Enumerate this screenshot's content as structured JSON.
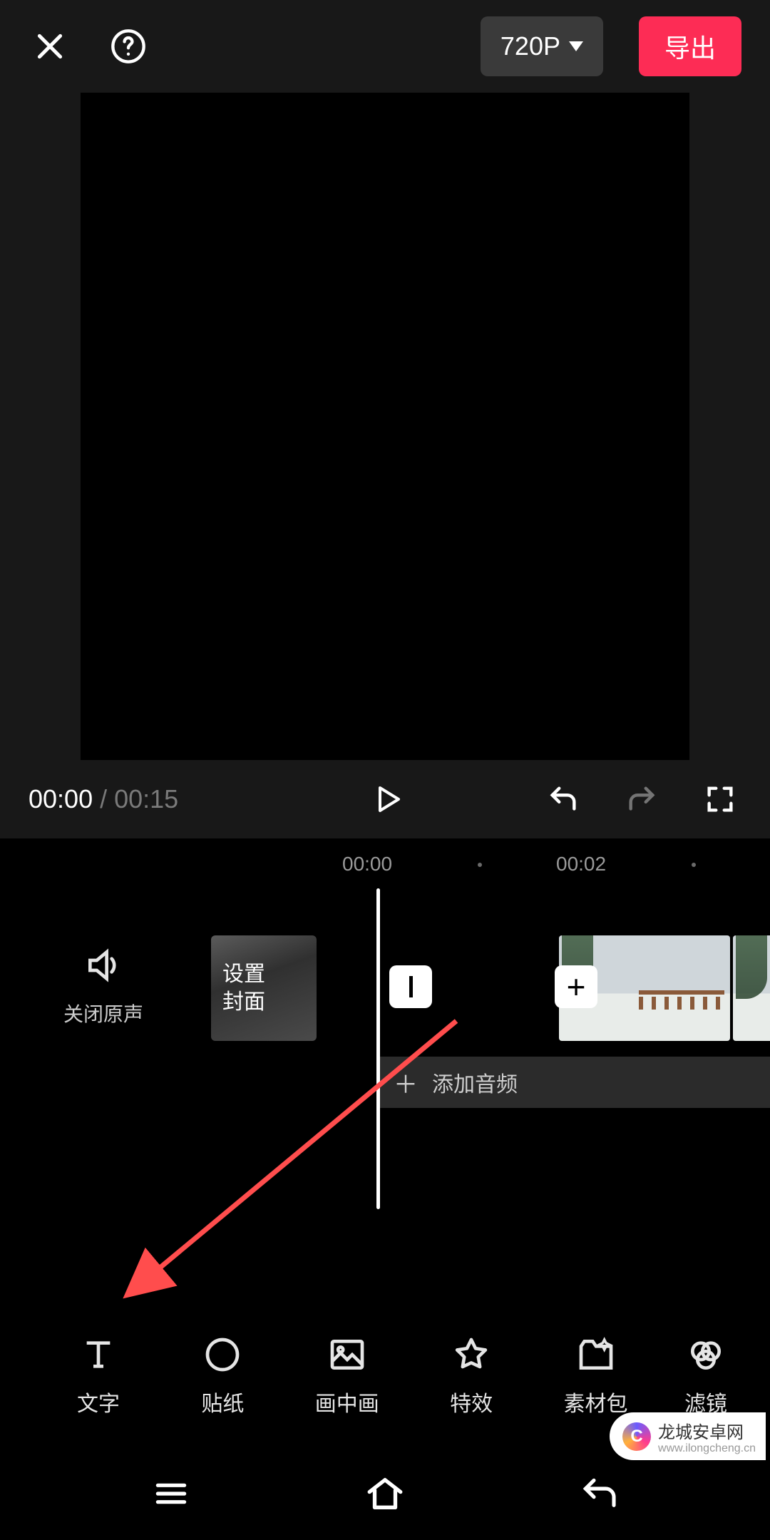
{
  "header": {
    "resolution_label": "720P",
    "export_label": "导出"
  },
  "playback": {
    "current_time": "00:00",
    "total_time": "00:15"
  },
  "timeline": {
    "ruler": [
      "00:00",
      "00:02"
    ],
    "mute_label": "关闭原声",
    "cover_line1": "设置",
    "cover_line2": "封面",
    "audio_add_label": "添加音频"
  },
  "toolbar": {
    "items": [
      {
        "id": "text",
        "label": "文字"
      },
      {
        "id": "sticker",
        "label": "贴纸"
      },
      {
        "id": "pip",
        "label": "画中画"
      },
      {
        "id": "effect",
        "label": "特效"
      },
      {
        "id": "material",
        "label": "素材包"
      },
      {
        "id": "filter",
        "label": "滤镜"
      }
    ]
  },
  "watermark": {
    "title": "龙城安卓网",
    "subtitle": "www.ilongcheng.cn"
  }
}
